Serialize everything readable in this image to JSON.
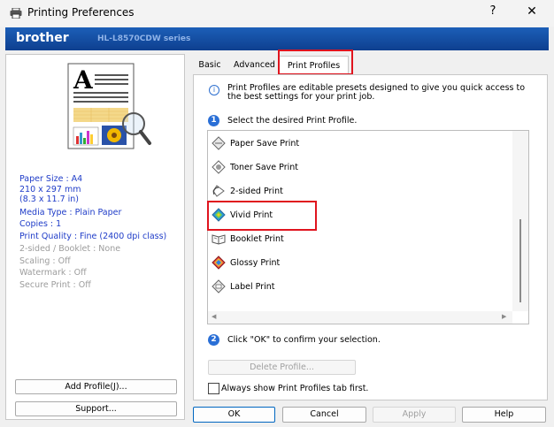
{
  "window": {
    "title": "Printing Preferences",
    "help_label": "?",
    "close_label": "✕"
  },
  "brand": {
    "logo": "brother",
    "model": "HL-L8570CDW series"
  },
  "summary": {
    "paper_size": "Paper Size : A4",
    "paper_dims_mm": "210 x 297 mm",
    "paper_dims_in": "(8.3 x 11.7 in)",
    "media_type": "Media Type : Plain Paper",
    "copies": "Copies : 1",
    "print_quality": "Print Quality : Fine (2400 dpi class)",
    "two_sided": "2-sided / Booklet : None",
    "scaling": "Scaling : Off",
    "watermark": "Watermark : Off",
    "secure_print": "Secure Print : Off"
  },
  "left_buttons": {
    "add_profile": "Add Profile(J)...",
    "support": "Support..."
  },
  "tabs": [
    {
      "label": "Basic"
    },
    {
      "label": "Advanced"
    },
    {
      "label": "Print Profiles"
    }
  ],
  "profiles_page": {
    "intro": "Print Profiles are editable presets designed to give you quick access to the best settings for your print job.",
    "step1_num": "1",
    "step1": "Select the desired Print Profile.",
    "step2_num": "2",
    "step2": "Click \"OK\" to confirm your selection.",
    "delete_button": "Delete Profile...",
    "always_show": "Always show Print Profiles tab first."
  },
  "profiles": [
    {
      "label": "Paper Save Print",
      "icon": "paper-save-icon"
    },
    {
      "label": "Toner Save Print",
      "icon": "toner-save-icon"
    },
    {
      "label": "2-sided Print",
      "icon": "two-sided-icon"
    },
    {
      "label": "Vivid Print",
      "icon": "vivid-icon"
    },
    {
      "label": "Booklet Print",
      "icon": "booklet-icon"
    },
    {
      "label": "Glossy Print",
      "icon": "glossy-icon"
    },
    {
      "label": "Label Print",
      "icon": "label-icon"
    }
  ],
  "footer": {
    "ok": "OK",
    "cancel": "Cancel",
    "apply": "Apply",
    "help": "Help"
  },
  "colors": {
    "brand_blue": "#1c5fb8",
    "highlight_red": "#e0141e",
    "summary_blue": "#1f3cc8"
  }
}
